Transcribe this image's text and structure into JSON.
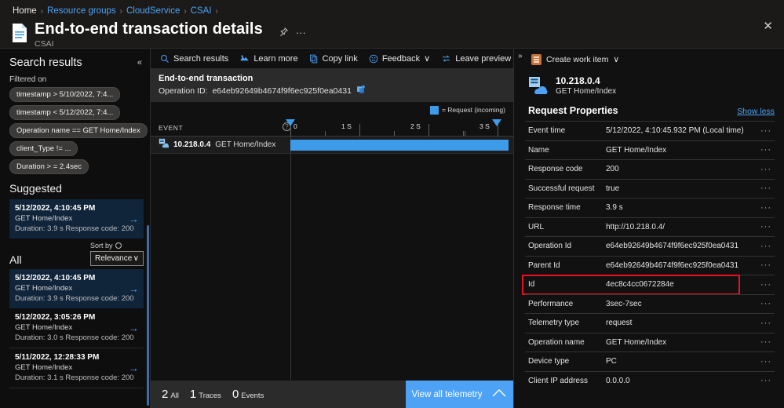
{
  "breadcrumb": {
    "items": [
      "Home",
      "Resource groups",
      "CloudService",
      "CSAI"
    ],
    "separator": "›"
  },
  "header": {
    "title": "End-to-end transaction details",
    "subtitle": "CSAI",
    "pin_icon": "pin-icon",
    "more_icon": "ellipsis-icon",
    "close_icon": "✕"
  },
  "sidebar": {
    "title": "Search results",
    "collapse_icon": "«",
    "filtered_on_label": "Filtered on",
    "chips": [
      "timestamp > 5/10/2022, 7:4...",
      "timestamp < 5/12/2022, 7:4...",
      "Operation name == GET Home/Index",
      "client_Type != ...",
      "Duration > = 2.4sec"
    ],
    "suggested_label": "Suggested",
    "suggested": [
      {
        "time": "5/12/2022, 4:10:45 PM",
        "operation": "GET Home/Index",
        "meta": "Duration: 3.9 s  Response code: 200",
        "arrow": "→"
      }
    ],
    "all_label": "All",
    "sort_by_label": "Sort by",
    "sort_value": "Relevance",
    "sort_chevron": "∨",
    "results": [
      {
        "time": "5/12/2022, 4:10:45 PM",
        "operation": "GET Home/Index",
        "meta": "Duration: 3.9 s  Response code: 200",
        "arrow": "→"
      },
      {
        "time": "5/12/2022, 3:05:26 PM",
        "operation": "GET Home/Index",
        "meta": "Duration: 3.0 s  Response code: 200",
        "arrow": "→"
      },
      {
        "time": "5/11/2022, 12:28:33 PM",
        "operation": "GET Home/Index",
        "meta": "Duration: 3.1 s  Response code: 200",
        "arrow": "→"
      }
    ]
  },
  "toolbar": {
    "search_results": "Search results",
    "learn_more": "Learn more",
    "copy_link": "Copy link",
    "feedback": "Feedback",
    "feedback_chevron": "∨",
    "leave_preview": "Leave preview"
  },
  "transaction": {
    "heading": "End-to-end transaction",
    "operation_id_label": "Operation ID:",
    "operation_id": "e64eb92649b4674f9f6ec925f0ea0431",
    "copy_icon": "copy-icon",
    "legend_text": "= Request (incoming)",
    "legend_color": "#3e9bea",
    "event_column_header": "EVENT",
    "help_icon": "?",
    "ruler_ticks": [
      "0",
      "1 S",
      "2 S",
      "3 S"
    ],
    "rows": [
      {
        "ip": "10.218.0.4",
        "operation": "GET Home/Index",
        "bar_start_pct": 0,
        "bar_end_pct": 97
      }
    ]
  },
  "statusbar": {
    "counts": [
      {
        "num": "2",
        "label": "All"
      },
      {
        "num": "1",
        "label": "Traces"
      },
      {
        "num": "0",
        "label": "Events"
      }
    ],
    "view_all_label": "View all telemetry",
    "view_all_chevron": "∧"
  },
  "details": {
    "expand_icon": "»",
    "create_work_item": "Create work item",
    "create_work_item_chevron": "∨",
    "resource_name": "10.218.0.4",
    "resource_operation": "GET Home/Index",
    "section_title": "Request Properties",
    "show_less": "Show less",
    "row_menu": "···",
    "properties": [
      {
        "key": "Event time",
        "value": "5/12/2022, 4:10:45.932 PM (Local time)",
        "highlight": false
      },
      {
        "key": "Name",
        "value": "GET Home/Index",
        "highlight": false
      },
      {
        "key": "Response code",
        "value": "200",
        "highlight": false
      },
      {
        "key": "Successful request",
        "value": "true",
        "highlight": false
      },
      {
        "key": "Response time",
        "value": "3.9 s",
        "highlight": false
      },
      {
        "key": "URL",
        "value": "http://10.218.0.4/",
        "highlight": false
      },
      {
        "key": "Operation Id",
        "value": "e64eb92649b4674f9f6ec925f0ea0431",
        "highlight": false
      },
      {
        "key": "Parent Id",
        "value": "e64eb92649b4674f9f6ec925f0ea0431",
        "highlight": false
      },
      {
        "key": "Id",
        "value": "4ec8c4cc0672284e",
        "highlight": true
      },
      {
        "key": "Performance",
        "value": "3sec-7sec",
        "highlight": false
      },
      {
        "key": "Telemetry type",
        "value": "request",
        "highlight": false
      },
      {
        "key": "Operation name",
        "value": "GET Home/Index",
        "highlight": false
      },
      {
        "key": "Device type",
        "value": "PC",
        "highlight": false
      },
      {
        "key": "Client IP address",
        "value": "0.0.0.0",
        "highlight": false
      }
    ]
  },
  "colors": {
    "accent": "#4da2f5",
    "bar": "#3e9bea",
    "highlight_border": "#e81123"
  }
}
